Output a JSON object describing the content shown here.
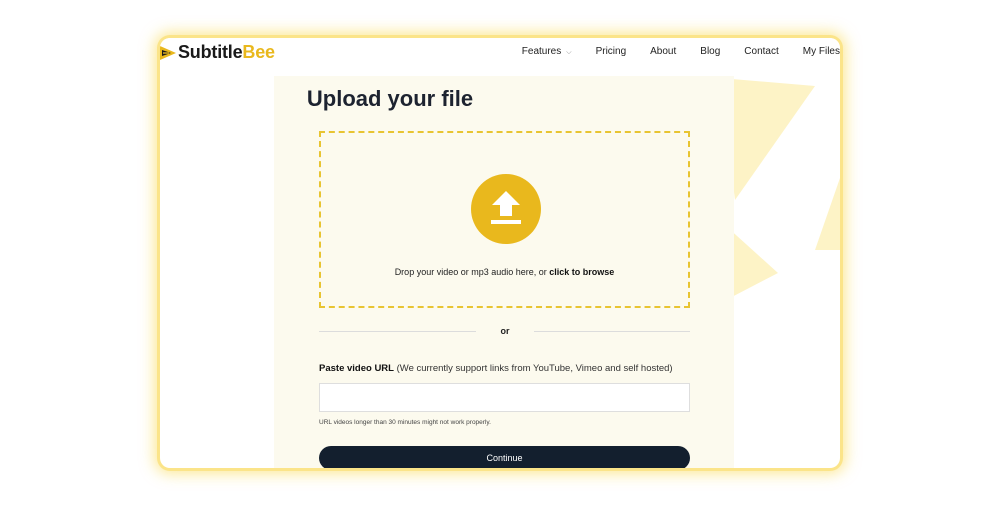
{
  "brand": {
    "name_part1": "Subtitle",
    "name_part2": "Bee",
    "accent_color": "#e9b81d",
    "dark_color": "#131f2e"
  },
  "nav": {
    "items": [
      {
        "label": "Features",
        "has_dropdown": true,
        "icon": "chevron-down-icon"
      },
      {
        "label": "Pricing"
      },
      {
        "label": "About"
      },
      {
        "label": "Blog"
      },
      {
        "label": "Contact"
      },
      {
        "label": "My Files"
      }
    ]
  },
  "upload": {
    "title": "Upload your file",
    "icon": "upload-arrow-icon",
    "drop_text": "Drop your video or mp3 audio here, or ",
    "browse_text": "click to browse",
    "divider_text": "or"
  },
  "url_section": {
    "label_bold": "Paste video URL",
    "label_rest": " (We currently support links from YouTube, Vimeo and self hosted)",
    "input_value": "",
    "input_placeholder": "",
    "hint": "URL videos longer than 30 minutes might not work properly.",
    "continue_label": "Continue"
  }
}
